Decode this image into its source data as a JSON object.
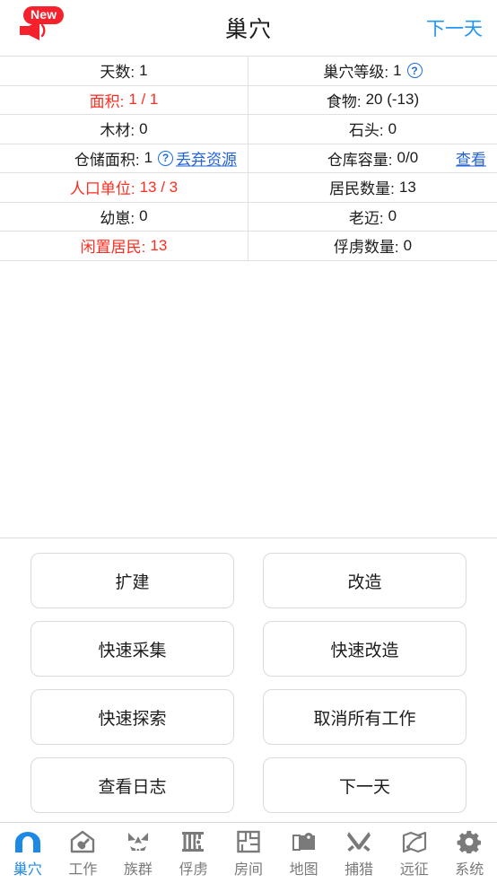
{
  "header": {
    "title": "巢穴",
    "next_day_label": "下一天",
    "badge_label": "New",
    "badge_icon": "megaphone-icon",
    "badge_color": "#f5222d",
    "link_color": "#2196f3"
  },
  "stats": {
    "rows": [
      {
        "left": {
          "label": "天数:",
          "value": "1",
          "alert": false,
          "help": false,
          "link": ""
        },
        "right": {
          "label": "巢穴等级:",
          "value": "1",
          "alert": false,
          "help": true,
          "link": ""
        }
      },
      {
        "left": {
          "label": "面积:",
          "value": "1 / 1",
          "alert": true,
          "help": false,
          "link": ""
        },
        "right": {
          "label": "食物:",
          "value": "20 (-13)",
          "alert": false,
          "help": false,
          "link": ""
        }
      },
      {
        "left": {
          "label": "木材:",
          "value": "0",
          "alert": false,
          "help": false,
          "link": ""
        },
        "right": {
          "label": "石头:",
          "value": "0",
          "alert": false,
          "help": false,
          "link": ""
        }
      },
      {
        "left": {
          "label": "仓储面积:",
          "value": "1",
          "alert": false,
          "help": true,
          "link": "丢弃资源"
        },
        "right": {
          "label": "仓库容量:",
          "value": "0/0",
          "alert": false,
          "help": false,
          "link": "查看"
        }
      },
      {
        "left": {
          "label": "人口单位:",
          "value": "13 / 3",
          "alert": true,
          "help": false,
          "link": ""
        },
        "right": {
          "label": "居民数量:",
          "value": "13",
          "alert": false,
          "help": false,
          "link": ""
        }
      },
      {
        "left": {
          "label": "幼崽:",
          "value": "0",
          "alert": false,
          "help": false,
          "link": ""
        },
        "right": {
          "label": "老迈:",
          "value": "0",
          "alert": false,
          "help": false,
          "link": ""
        }
      },
      {
        "left": {
          "label": "闲置居民:",
          "value": "13",
          "alert": true,
          "value_alert": true,
          "help": false,
          "link": ""
        },
        "right": {
          "label": "俘虏数量:",
          "value": "0",
          "alert": false,
          "help": false,
          "link": ""
        }
      }
    ],
    "help_icon": "question-circle-icon",
    "alert_color": "#ff2d1f",
    "link_color": "#2464d8"
  },
  "actions": {
    "buttons": [
      {
        "label": "扩建"
      },
      {
        "label": "改造"
      },
      {
        "label": "快速采集"
      },
      {
        "label": "快速改造"
      },
      {
        "label": "快速探索"
      },
      {
        "label": "取消所有工作"
      },
      {
        "label": "查看日志"
      },
      {
        "label": "下一天"
      }
    ]
  },
  "tabbar": {
    "active_index": 0,
    "active_color": "#1e88e5",
    "inactive_color": "#7a7a7a",
    "tabs": [
      {
        "label": "巢穴",
        "icon": "cave-arch-icon"
      },
      {
        "label": "工作",
        "icon": "house-work-icon"
      },
      {
        "label": "族群",
        "icon": "tribal-mask-icon"
      },
      {
        "label": "俘虏",
        "icon": "prison-bars-icon"
      },
      {
        "label": "房间",
        "icon": "floor-plan-icon"
      },
      {
        "label": "地图",
        "icon": "map-pin-icon"
      },
      {
        "label": "捕猎",
        "icon": "crossed-swords-icon"
      },
      {
        "label": "远征",
        "icon": "expedition-route-icon"
      },
      {
        "label": "系统",
        "icon": "gear-icon"
      }
    ]
  }
}
